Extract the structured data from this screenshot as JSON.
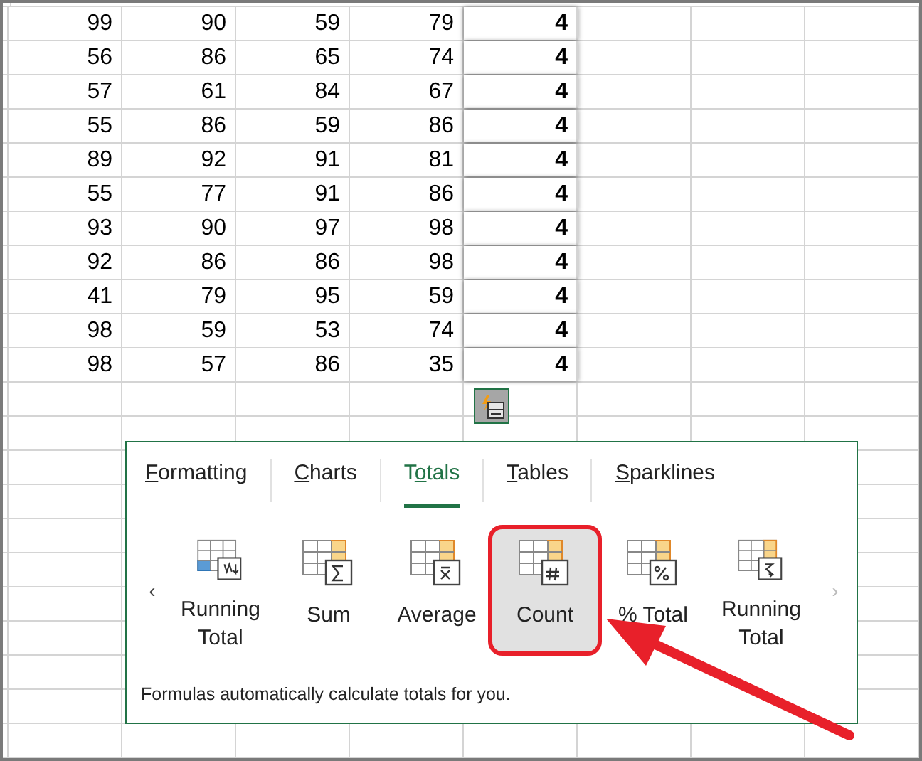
{
  "sheet": {
    "rows": [
      [
        "99",
        "90",
        "59",
        "79",
        "4"
      ],
      [
        "56",
        "86",
        "65",
        "74",
        "4"
      ],
      [
        "57",
        "61",
        "84",
        "67",
        "4"
      ],
      [
        "55",
        "86",
        "59",
        "86",
        "4"
      ],
      [
        "89",
        "92",
        "91",
        "81",
        "4"
      ],
      [
        "55",
        "77",
        "91",
        "86",
        "4"
      ],
      [
        "93",
        "90",
        "97",
        "98",
        "4"
      ],
      [
        "92",
        "86",
        "86",
        "98",
        "4"
      ],
      [
        "41",
        "79",
        "95",
        "59",
        "4"
      ],
      [
        "98",
        "59",
        "53",
        "74",
        "4"
      ],
      [
        "98",
        "57",
        "86",
        "35",
        "4"
      ]
    ]
  },
  "quick_analysis": {
    "tabs": [
      {
        "access_key": "F",
        "rest": "ormatting",
        "selected": false
      },
      {
        "access_key": "C",
        "rest": "harts",
        "selected": false
      },
      {
        "lead": "T",
        "access_key": "o",
        "rest": "tals",
        "selected": true
      },
      {
        "access_key": "T",
        "rest": "ables",
        "selected": false
      },
      {
        "access_key": "S",
        "rest": "parklines",
        "selected": false
      }
    ],
    "prev": "‹",
    "next": "›",
    "items": [
      {
        "kind": "running",
        "label": "Running Total",
        "selected": false,
        "highlighted": false
      },
      {
        "kind": "sum",
        "label": "Sum",
        "selected": false,
        "highlighted": false
      },
      {
        "kind": "average",
        "label": "Average",
        "selected": false,
        "highlighted": false
      },
      {
        "kind": "count",
        "label": "Count",
        "selected": true,
        "highlighted": true
      },
      {
        "kind": "percent",
        "label": "% Total",
        "selected": false,
        "highlighted": false
      },
      {
        "kind": "running_row",
        "label": "Running Total",
        "selected": false,
        "highlighted": false
      }
    ],
    "description": "Formulas automatically calculate totals for you."
  }
}
